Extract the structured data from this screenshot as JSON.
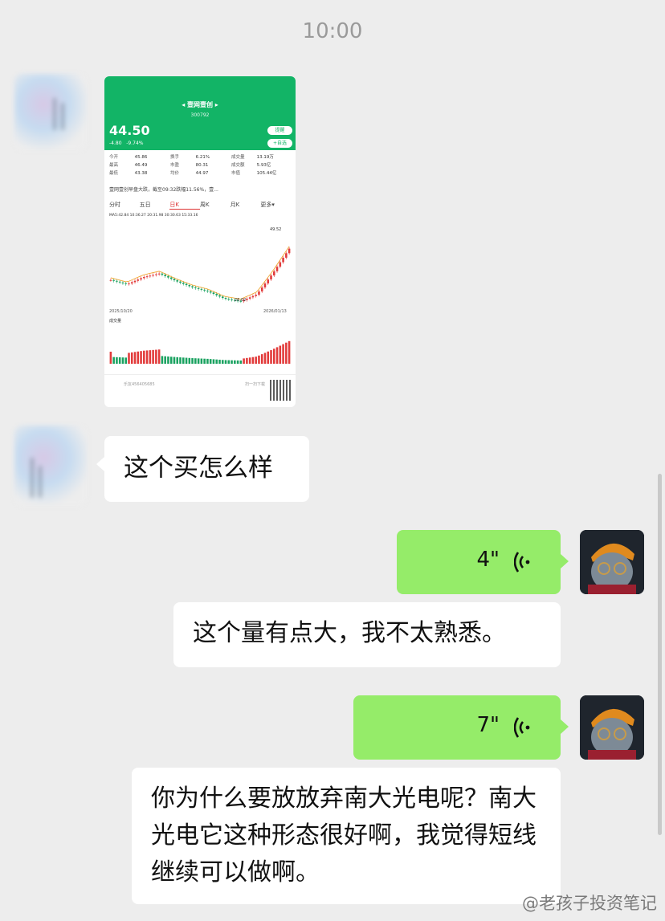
{
  "status": {
    "time": "10:00"
  },
  "stock": {
    "name": "◂ 壹网壹创 ▸",
    "code": "300792",
    "price": "44.50",
    "change": "-4.80",
    "change_pct": "-9.74%",
    "remind_label": "提醒",
    "watch_label": "+自选",
    "stats": [
      [
        "今开",
        "45.86",
        "换手",
        "6.21%",
        "成交量",
        "13.19万"
      ],
      [
        "最高",
        "46.49",
        "市盈",
        "80.31",
        "成交额",
        "5.93亿"
      ],
      [
        "最低",
        "43.38",
        "均价",
        "44.97",
        "市值",
        "105.44亿"
      ]
    ],
    "news": "壹网壹创早盘大跌，截至09:32跌幅11.56%，壹...",
    "tabs": [
      "分时",
      "五日",
      "日K",
      "周K",
      "月K",
      "更多▾"
    ],
    "active_tab": "日K",
    "ma_line": "MA5:42.84  10:36.27  20:31.98  30:30.63  15:33.16",
    "peak_label": "49.52",
    "low_label": "26.02",
    "date_start": "2025/10/20",
    "date_end": "2026/01/13",
    "volume_label": "成交量",
    "footer_left": "乐友456405685",
    "footer_right": "扫一扫下载"
  },
  "chart_data": {
    "type": "line",
    "title": "",
    "x": [
      "2025/10/20",
      "",
      "",
      "",
      "",
      "",
      "",
      "",
      "",
      "",
      "",
      "2026/01/13"
    ],
    "series": [
      {
        "values": [
          33.5,
          32.0,
          34.5,
          35.8,
          33.2,
          31.0,
          29.5,
          27.0,
          26.02,
          28.5,
          36.0,
          44.5
        ]
      }
    ],
    "ylim": [
      25,
      52
    ],
    "grid": false
  },
  "messages": [
    {
      "type": "text",
      "side": "left",
      "text": "这个买怎么样"
    },
    {
      "type": "voice",
      "side": "right",
      "duration": "4\"",
      "transcript": "这个量有点大，我不太熟悉。"
    },
    {
      "type": "voice",
      "side": "right",
      "duration": "7\"",
      "transcript": "你为什么要放放弃南大光电呢？南大光电它这种形态很好啊，我觉得短线继续可以做啊。"
    }
  ],
  "watermark": "@老孩子投资笔记",
  "icons": [
    "voice-wave-icon",
    "contact-avatar",
    "cat-avatar"
  ]
}
